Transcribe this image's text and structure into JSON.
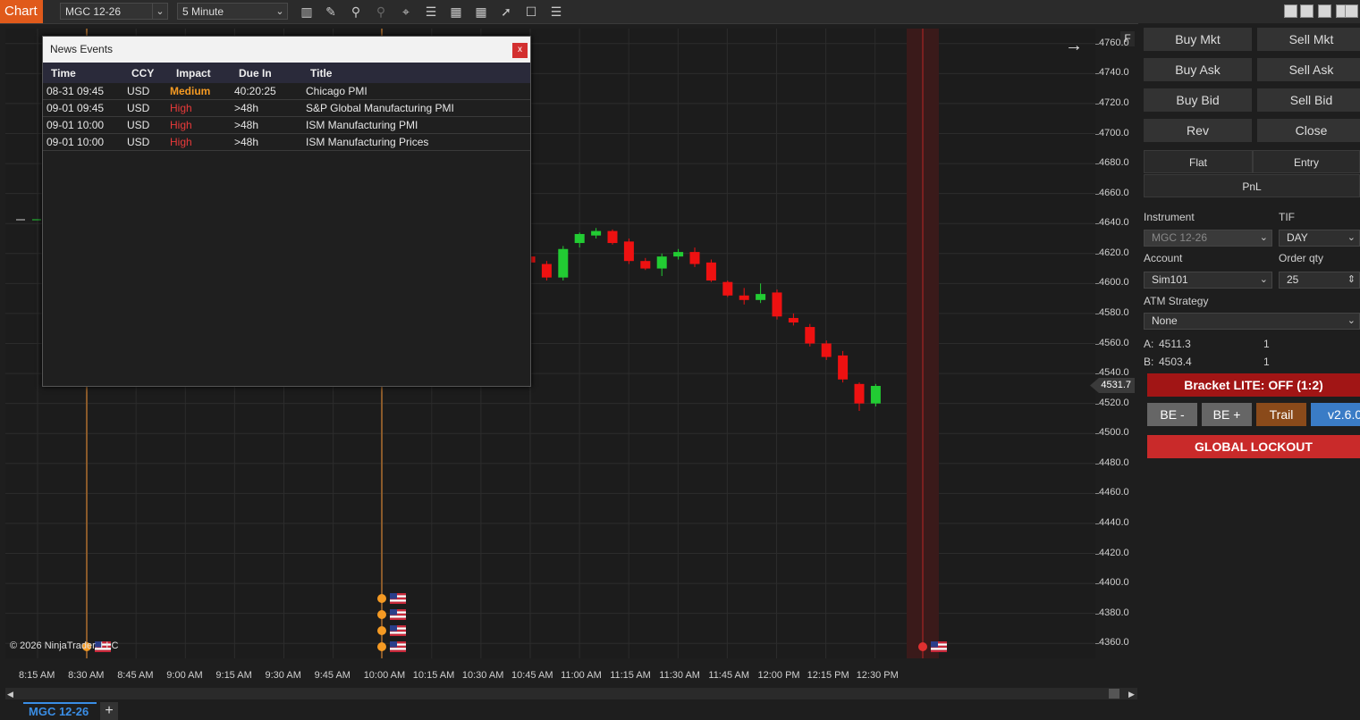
{
  "toolbar": {
    "chart_tab": "Chart",
    "instrument": "MGC 12-26",
    "interval": "5 Minute",
    "icons": [
      "bars-icon",
      "pencil-icon",
      "zoom-in-icon",
      "zoom-out-icon",
      "crosshair-icon",
      "properties-icon",
      "indicators-icon",
      "strategies-icon",
      "drawing-tools-icon",
      "data-box-icon",
      "list-icon"
    ]
  },
  "chart": {
    "copyright": "© 2026 NinjaTrader, LLC",
    "current_price": "4531.7",
    "expand_label": "F",
    "price_labels": [
      "4760.0",
      "4740.0",
      "4720.0",
      "4700.0",
      "4680.0",
      "4660.0",
      "4640.0",
      "4620.0",
      "4600.0",
      "4580.0",
      "4560.0",
      "4540.0",
      "4520.0",
      "4500.0",
      "4480.0",
      "4460.0",
      "4440.0",
      "4420.0",
      "4400.0",
      "4380.0",
      "4360.0"
    ],
    "time_labels": [
      "8:15 AM",
      "8:30 AM",
      "8:45 AM",
      "9:00 AM",
      "9:15 AM",
      "9:30 AM",
      "9:45 AM",
      "10:00 AM",
      "10:15 AM",
      "10:30 AM",
      "10:45 AM",
      "11:00 AM",
      "11:15 AM",
      "11:30 AM",
      "11:45 AM",
      "12:00 PM",
      "12:15 PM",
      "12:30 PM"
    ],
    "colors": {
      "up": "#22cc33",
      "down": "#ee1111",
      "event_line": "#8a5a2a",
      "event_dot": "#f59a23",
      "event_high": "#e03030"
    }
  },
  "chart_data": {
    "type": "candlestick",
    "y_range": [
      4350,
      4770
    ],
    "candles": [
      {
        "t": "10:45 AM-",
        "o": 4618,
        "h": 4621,
        "l": 4614,
        "c": 4614
      },
      {
        "t": "10:50 AM",
        "o": 4613,
        "h": 4615,
        "l": 4602,
        "c": 4604
      },
      {
        "t": "10:55 AM",
        "o": 4604,
        "h": 4625,
        "l": 4602,
        "c": 4623
      },
      {
        "t": "11:00 AM",
        "o": 4627,
        "h": 4634,
        "l": 4624,
        "c": 4633
      },
      {
        "t": "11:05 AM",
        "o": 4632,
        "h": 4637,
        "l": 4630,
        "c": 4635
      },
      {
        "t": "11:10 AM",
        "o": 4635,
        "h": 4636,
        "l": 4626,
        "c": 4627
      },
      {
        "t": "11:15 AM",
        "o": 4628,
        "h": 4630,
        "l": 4613,
        "c": 4615
      },
      {
        "t": "11:20 AM",
        "o": 4615,
        "h": 4617,
        "l": 4609,
        "c": 4610
      },
      {
        "t": "11:25 AM",
        "o": 4610,
        "h": 4620,
        "l": 4605,
        "c": 4618
      },
      {
        "t": "11:30 AM",
        "o": 4618,
        "h": 4623,
        "l": 4616,
        "c": 4621
      },
      {
        "t": "11:35 AM",
        "o": 4621,
        "h": 4624,
        "l": 4611,
        "c": 4613
      },
      {
        "t": "11:40 AM",
        "o": 4614,
        "h": 4616,
        "l": 4601,
        "c": 4602
      },
      {
        "t": "11:45 AM",
        "o": 4601,
        "h": 4602,
        "l": 4591,
        "c": 4592
      },
      {
        "t": "11:50 AM",
        "o": 4592,
        "h": 4597,
        "l": 4586,
        "c": 4589
      },
      {
        "t": "11:55 AM",
        "o": 4589,
        "h": 4600,
        "l": 4587,
        "c": 4593
      },
      {
        "t": "12:00 PM",
        "o": 4594,
        "h": 4596,
        "l": 4576,
        "c": 4578
      },
      {
        "t": "12:05 PM",
        "o": 4577,
        "h": 4580,
        "l": 4572,
        "c": 4574
      },
      {
        "t": "12:10 PM",
        "o": 4571,
        "h": 4573,
        "l": 4558,
        "c": 4560
      },
      {
        "t": "12:15 PM",
        "o": 4560,
        "h": 4562,
        "l": 4549,
        "c": 4551
      },
      {
        "t": "12:20 PM",
        "o": 4552,
        "h": 4555,
        "l": 4534,
        "c": 4536
      },
      {
        "t": "12:25 PM",
        "o": 4533,
        "h": 4534,
        "l": 4515,
        "c": 4520
      },
      {
        "t": "12:30 PM",
        "o": 4520,
        "h": 4533,
        "l": 4518,
        "c": 4531.7
      }
    ]
  },
  "news": {
    "title": "News Events",
    "close": "x",
    "columns": [
      "Time",
      "CCY",
      "Impact",
      "Due In",
      "Title"
    ],
    "rows": [
      {
        "time": "08-31 09:45",
        "ccy": "USD",
        "impact": "Medium",
        "due": "40:20:25",
        "title": "Chicago PMI"
      },
      {
        "time": "09-01 09:45",
        "ccy": "USD",
        "impact": "High",
        "due": ">48h",
        "title": "S&P Global Manufacturing PMI"
      },
      {
        "time": "09-01 10:00",
        "ccy": "USD",
        "impact": "High",
        "due": ">48h",
        "title": "ISM Manufacturing PMI"
      },
      {
        "time": "09-01 10:00",
        "ccy": "USD",
        "impact": "High",
        "due": ">48h",
        "title": "ISM Manufacturing Prices"
      }
    ]
  },
  "panel": {
    "buy_mkt": "Buy Mkt",
    "sell_mkt": "Sell Mkt",
    "buy_ask": "Buy Ask",
    "sell_ask": "Sell Ask",
    "buy_bid": "Buy Bid",
    "sell_bid": "Sell Bid",
    "rev": "Rev",
    "close": "Close",
    "flat": "Flat",
    "entry": "Entry",
    "pnl": "PnL",
    "instrument_label": "Instrument",
    "instrument_value": "MGC 12-26",
    "tif_label": "TIF",
    "tif_value": "DAY",
    "account_label": "Account",
    "account_value": "Sim101",
    "qty_label": "Order qty",
    "qty_value": "25",
    "atm_label": "ATM Strategy",
    "atm_value": "None",
    "ask_label": "A:",
    "ask_price": "4511.3",
    "ask_qty": "1",
    "bid_label": "B:",
    "bid_price": "4503.4",
    "bid_qty": "1",
    "bracket": "Bracket LITE: OFF (1:2)",
    "be_minus": "BE -",
    "be_plus": "BE +",
    "trail": "Trail",
    "version": "v2.6.0",
    "lockout": "GLOBAL LOCKOUT"
  },
  "bottom": {
    "tab": "MGC 12-26",
    "add": "+"
  }
}
